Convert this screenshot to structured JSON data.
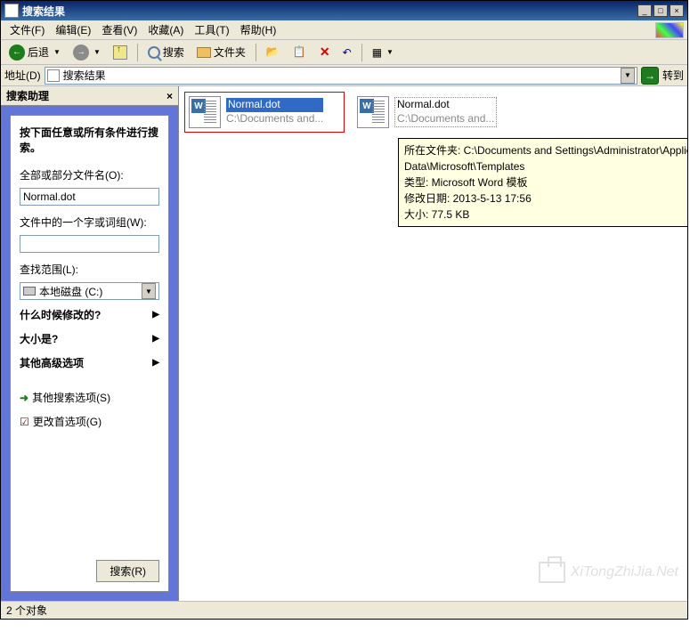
{
  "window": {
    "title": "搜索结果"
  },
  "titlebar_buttons": {
    "min": "_",
    "max": "□",
    "close": "×"
  },
  "menu": {
    "file": "文件(F)",
    "edit": "编辑(E)",
    "view": "查看(V)",
    "favorites": "收藏(A)",
    "tools": "工具(T)",
    "help": "帮助(H)"
  },
  "toolbar": {
    "back": "后退",
    "search": "搜索",
    "folders": "文件夹"
  },
  "addressbar": {
    "label": "地址(D)",
    "value": "搜索结果",
    "go": "转到"
  },
  "sidebar": {
    "header": "搜索助理",
    "panel_title": "按下面任意或所有条件进行搜索。",
    "filename_label": "全部或部分文件名(O):",
    "filename_value": "Normal.dot",
    "content_label": "文件中的一个字或词组(W):",
    "content_value": "",
    "lookin_label": "查找范围(L):",
    "lookin_value": "本地磁盘 (C:)",
    "when_label": "什么时候修改的?",
    "size_label": "大小是?",
    "advanced_label": "其他高级选项",
    "other_search": "其他搜索选项(S)",
    "change_prefs": "更改首选项(G)",
    "search_btn": "搜索(R)"
  },
  "results": [
    {
      "name": "Normal.dot",
      "path": "C:\\Documents and...",
      "selected": true
    },
    {
      "name": "Normal.dot",
      "path": "C:\\Documents and...",
      "selected": false
    }
  ],
  "tooltip": {
    "line1": "所在文件夹: C:\\Documents and Settings\\Administrator\\Application Data\\Microsoft\\Templates",
    "line2": "类型: Microsoft Word 模板",
    "line3": "修改日期: 2013-5-13 17:56",
    "line4": "大小: 77.5 KB"
  },
  "statusbar": {
    "text": "2 个对象"
  },
  "watermark": "XiTongZhiJia.Net"
}
